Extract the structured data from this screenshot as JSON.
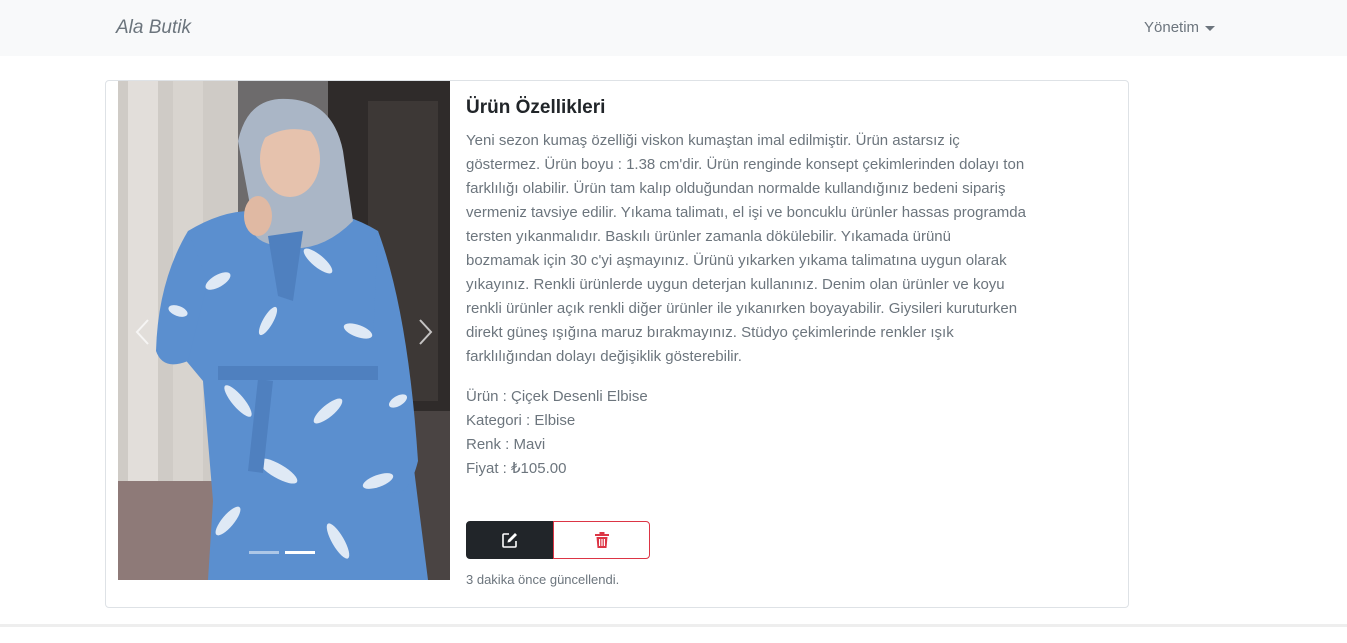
{
  "navbar": {
    "brand": "Ala Butik",
    "menu_label": "Yönetim",
    "caret_icon": "caret-down-icon"
  },
  "product": {
    "title": "Ürün Özellikleri",
    "description": "Yeni sezon kumaş özelliği viskon kumaştan imal edilmiştir. Ürün astarsız iç göstermez. Ürün boyu : 1.38 cm'dir. Ürün renginde konsept çekimlerinden dolayı ton farklılığı olabilir. Ürün tam kalıp olduğundan normalde kullandığınız bedeni sipariş vermeniz tavsiye edilir. Yıkama talimatı, el işi ve boncuklu ürünler hassas programda tersten yıkanmalıdır. Baskılı ürünler zamanla dökülebilir. Yıkamada ürünü bozmamak için 30 c'yi aşmayınız. Ürünü yıkarken yıkama talimatına uygun olarak yıkayınız. Renkli ürünlerde uygun deterjan kullanınız. Denim olan ürünler ve koyu renkli ürünler açık renkli diğer ürünler ile yıkanırken boyayabilir. Giysileri kuruturken direkt güneş ışığına maruz bırakmayınız. Stüdyo çekimlerinde renkler ışık farklılığından dolayı değişiklik gösterebilir.",
    "name_line": "Ürün : Çiçek Desenli Elbise",
    "category_line": "Kategori : Elbise",
    "color_line": "Renk : Mavi",
    "price_line": "Fiyat : ₺105.00",
    "updated": "3 dakika önce güncellendi."
  },
  "carousel": {
    "slide_count": 2,
    "active_index": 1,
    "prev_icon": "chevron-left-icon",
    "next_icon": "chevron-right-icon"
  },
  "actions": {
    "edit_icon": "edit-icon",
    "delete_icon": "trash-icon"
  },
  "colors": {
    "navbar_bg": "#f8f9fa",
    "text_muted": "#6c757d",
    "dark": "#212529",
    "danger": "#dc3545",
    "dress_blue": "#5b8fcf"
  }
}
